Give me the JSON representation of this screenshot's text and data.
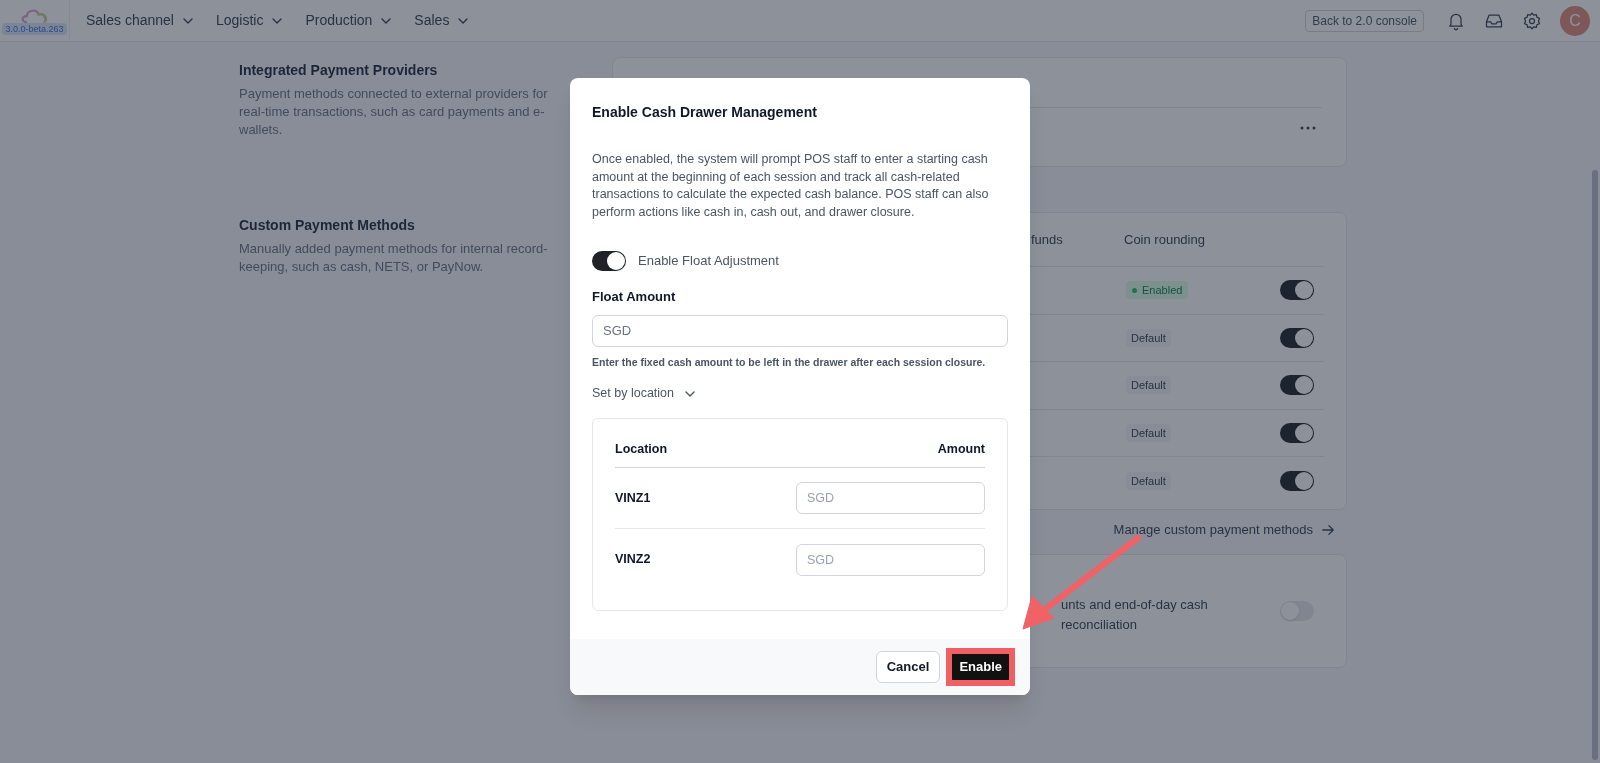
{
  "top_bar": {
    "version": "3.0.0-beta.263",
    "nav": [
      {
        "label": "Sales channel"
      },
      {
        "label": "Logistic"
      },
      {
        "label": "Production"
      },
      {
        "label": "Sales"
      }
    ],
    "console_button": "Back to 2.0 console",
    "avatar": "C"
  },
  "sections": [
    {
      "title": "Integrated Payment Providers",
      "description": "Payment methods connected to external providers for real-time transactions, such as card payments and e-wallets."
    },
    {
      "title": "Custom Payment Methods",
      "description": "Manually added payment methods for internal record-keeping, such as cash, NETS, or PayNow."
    }
  ],
  "custom_methods": {
    "columns": [
      "funds",
      "Coin rounding"
    ],
    "rows": [
      {
        "badge": "Enabled",
        "kind": "enabled",
        "on": true
      },
      {
        "badge": "Default",
        "kind": "default",
        "on": true
      },
      {
        "badge": "Default",
        "kind": "default",
        "on": true
      },
      {
        "badge": "Default",
        "kind": "default",
        "on": true
      },
      {
        "badge": "Default",
        "kind": "default",
        "on": true
      }
    ],
    "link": "Manage custom payment methods"
  },
  "cash_card": {
    "text": "unts and end-of-day cash reconciliation",
    "on": false
  },
  "modal": {
    "title": "Enable Cash Drawer Management",
    "description": "Once enabled, the system will prompt POS staff to enter a starting cash amount at the beginning of each session and track all cash-related transactions to calculate the expected cash balance. POS staff can also perform actions like cash in, cash out, and drawer closure.",
    "float_toggle": {
      "label": "Enable Float Adjustment",
      "on": true
    },
    "float_amount": {
      "label": "Float Amount",
      "placeholder": "SGD",
      "hint": "Enter the fixed cash amount to be left in the drawer after each session closure."
    },
    "set_by_location": {
      "label": "Set by location",
      "expanded": true
    },
    "location_table": {
      "columns": [
        "Location",
        "Amount"
      ],
      "rows": [
        {
          "location": "VINZ1",
          "placeholder": "SGD"
        },
        {
          "location": "VINZ2",
          "placeholder": "SGD"
        }
      ]
    },
    "buttons": {
      "cancel": "Cancel",
      "confirm": "Enable"
    }
  }
}
